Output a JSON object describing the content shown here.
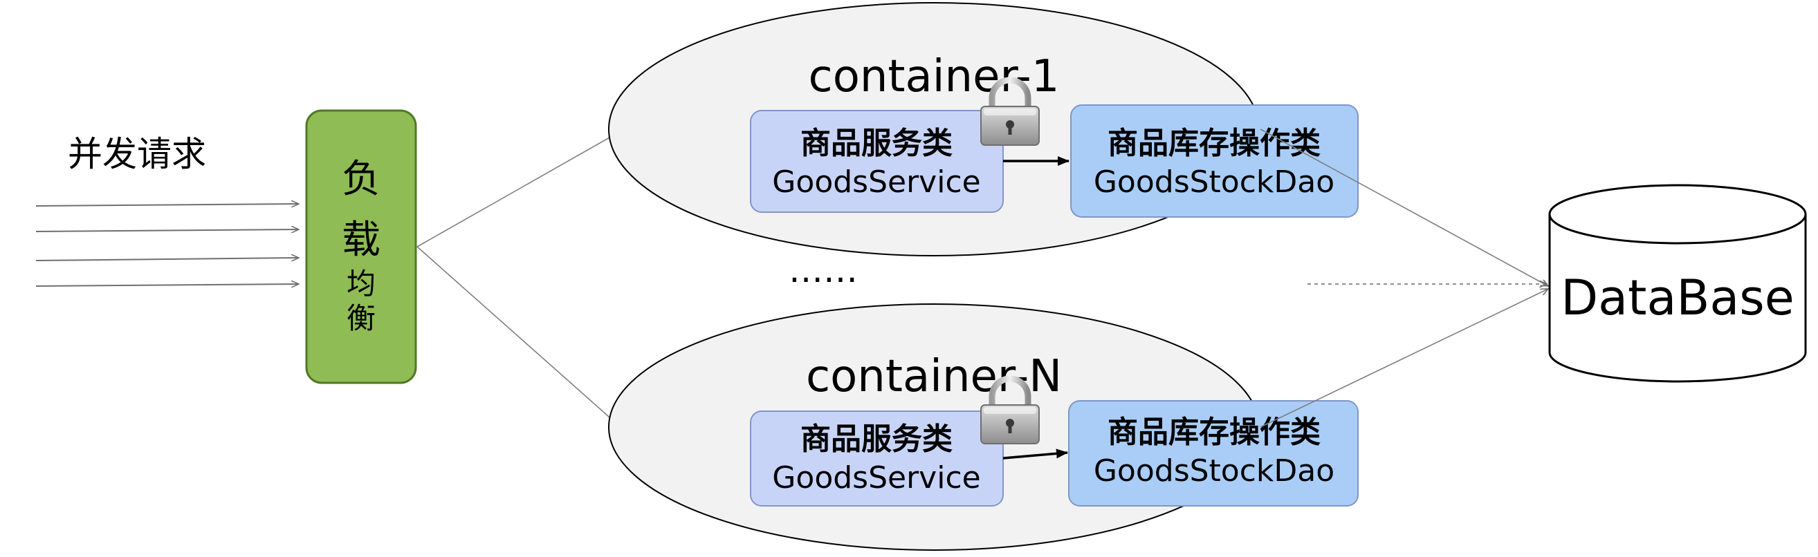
{
  "concurrent_requests": "并发请求",
  "load_balancer": {
    "label_chars": [
      "负",
      "载",
      "均",
      "衡"
    ],
    "fill": "#8fbc54",
    "stroke": "#4f7a25"
  },
  "ellipsis": "……",
  "database": {
    "label": "DataBase"
  },
  "containers": [
    {
      "title": "container-1",
      "service": {
        "name_cn": "商品服务类",
        "name_en": "GoodsService"
      },
      "dao": {
        "name_cn": "商品库存操作类",
        "name_en": "GoodsStockDao"
      }
    },
    {
      "title": "container-N",
      "service": {
        "name_cn": "商品服务类",
        "name_en": "GoodsService"
      },
      "dao": {
        "name_cn": "商品库存操作类",
        "name_en": "GoodsStockDao"
      }
    }
  ],
  "colors": {
    "container_fill": "#f2f2f2",
    "service_fill": "#c8d4f7",
    "dao_fill": "#a9cdf7",
    "box_stroke": "#7f96c8",
    "line": "#7f7f7f"
  }
}
